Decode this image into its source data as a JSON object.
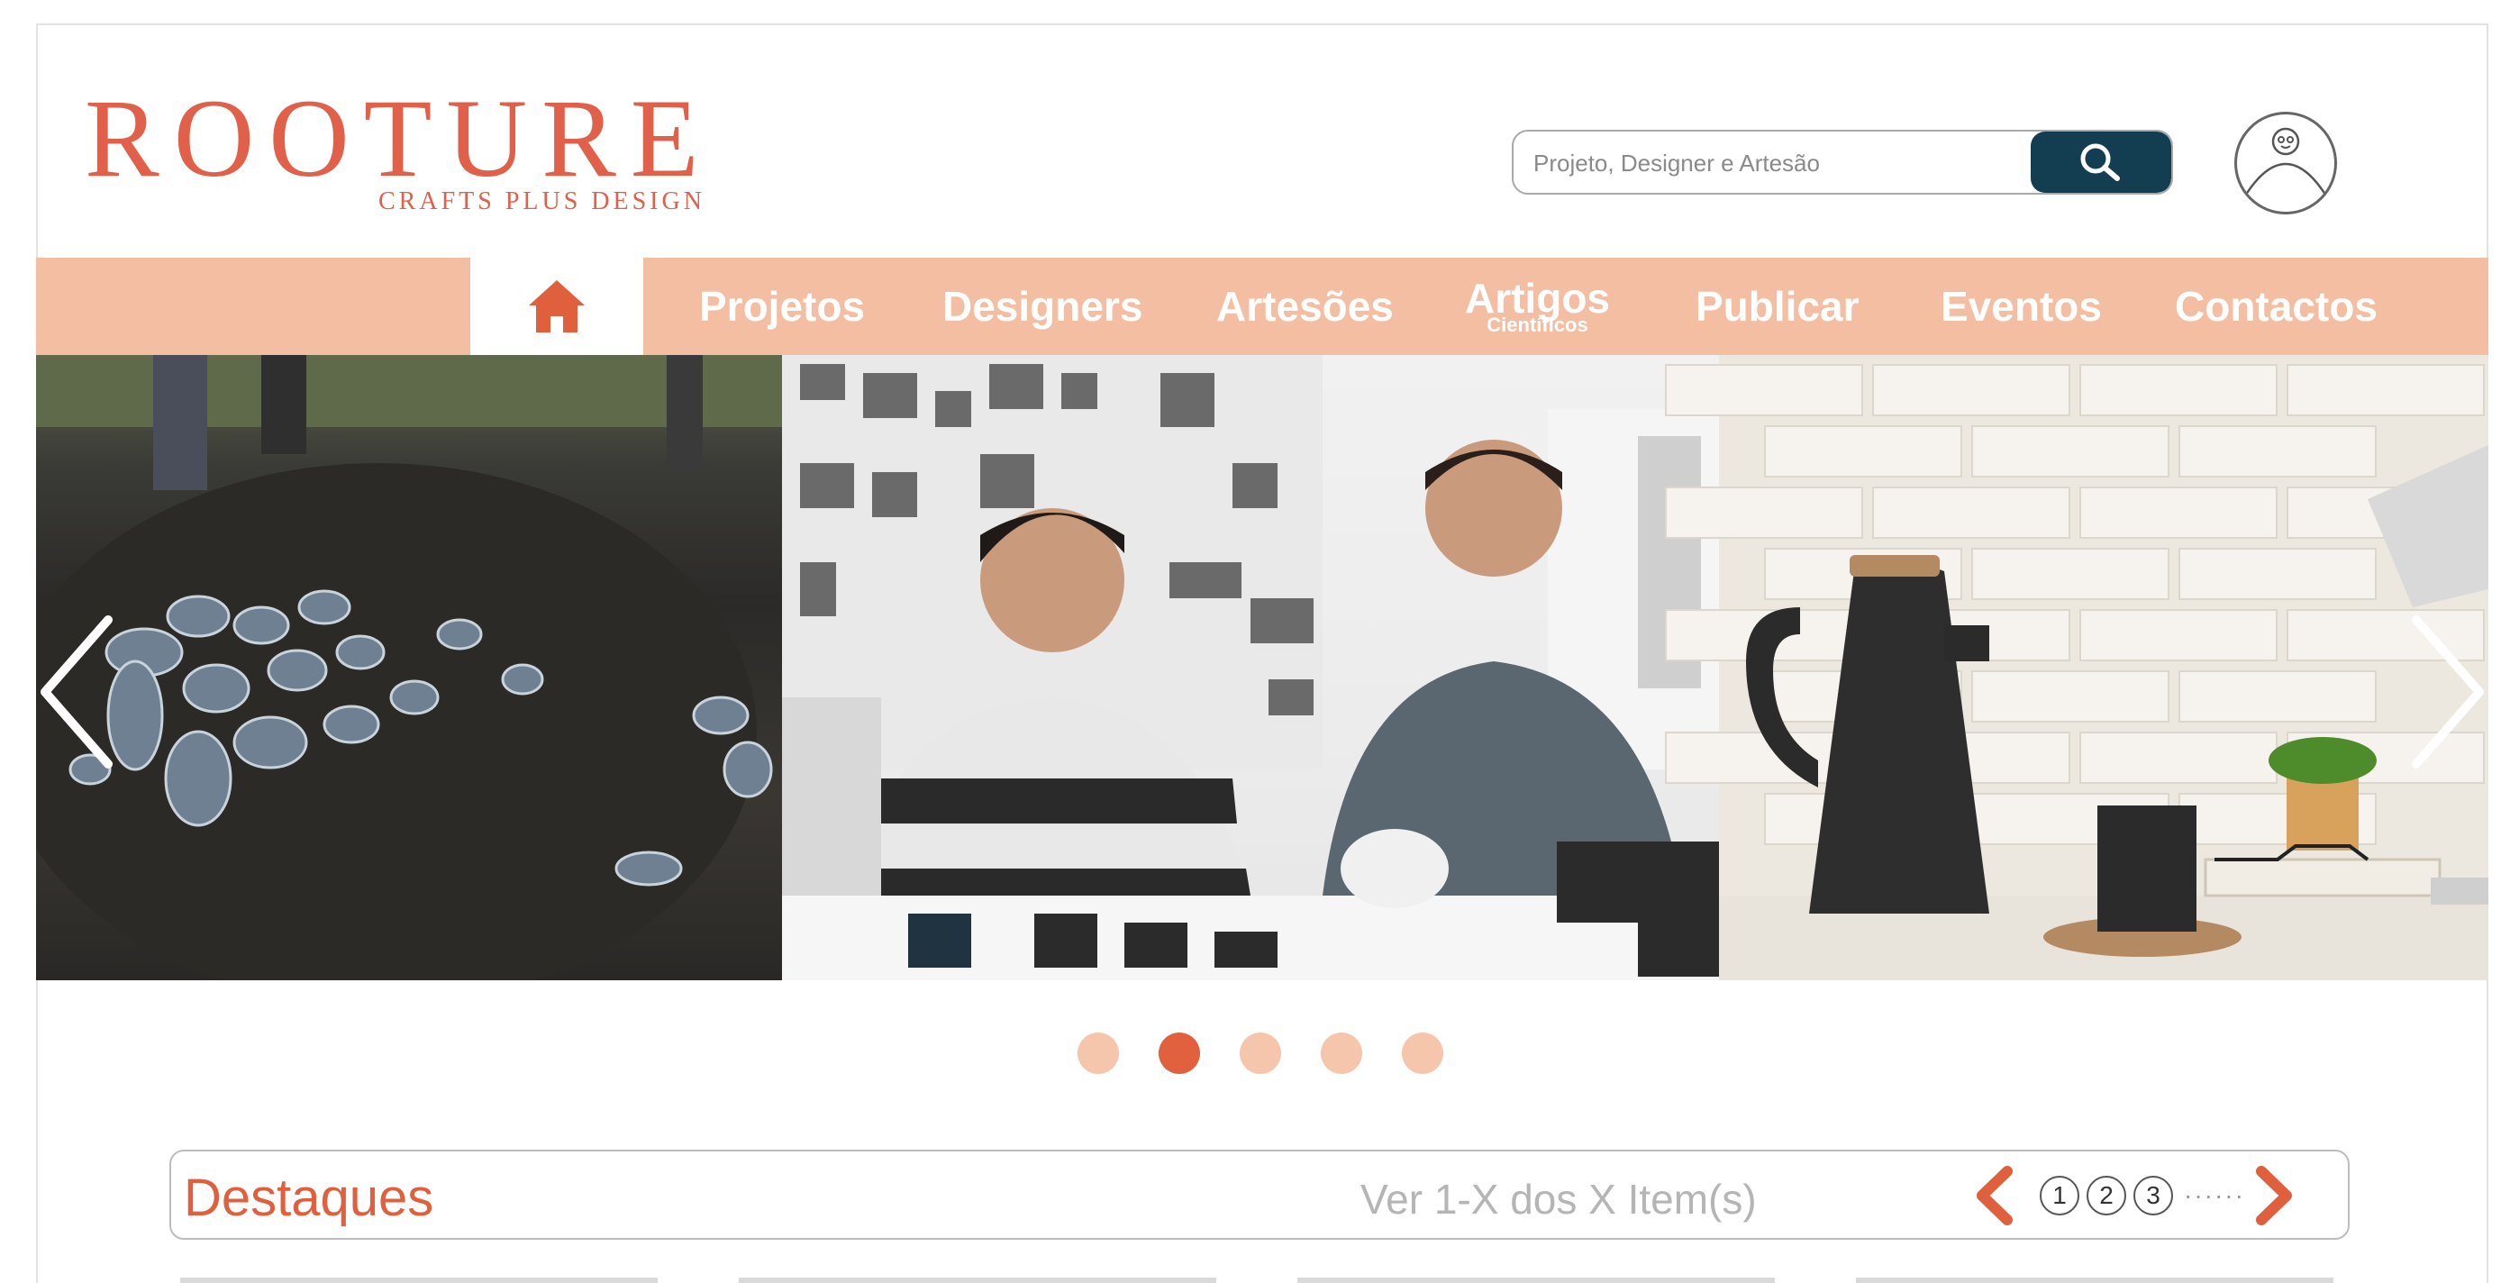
{
  "brand": {
    "name": "ROOTURE",
    "tagline": "CRAFTS PLUS DESIGN",
    "color": "#e0604a"
  },
  "search": {
    "placeholder": "Projeto, Designer e Artesão",
    "button_icon": "search-icon",
    "button_color": "#133e52"
  },
  "user": {
    "icon": "user-avatar-icon"
  },
  "nav": {
    "background": "#f3bea2",
    "home_icon": "home-icon",
    "items": [
      {
        "label": "Projetos"
      },
      {
        "label": "Designers"
      },
      {
        "label": "Artesões"
      },
      {
        "label": "Artigos",
        "sublabel": "Científicos"
      },
      {
        "label": "Publicar"
      },
      {
        "label": "Eventos"
      },
      {
        "label": "Contactos"
      }
    ]
  },
  "carousel": {
    "slides": [
      "pottery-firing-photo",
      "designers-photo",
      "black-ceramic-teapot-photo"
    ],
    "dots": 5,
    "active_dot": 2,
    "prev_icon": "chevron-left-icon",
    "next_icon": "chevron-right-icon"
  },
  "highlights": {
    "title": "Destaques",
    "count_text": "Ver 1-X dos X Item(s)",
    "pages": [
      "1",
      "2",
      "3"
    ],
    "more": "······",
    "accent": "#e0603e"
  }
}
